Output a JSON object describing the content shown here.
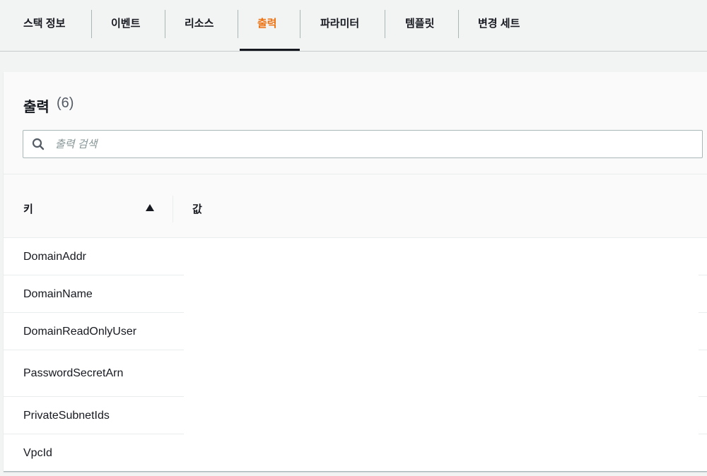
{
  "tabs": [
    {
      "label": "스택 정보",
      "active": false
    },
    {
      "label": "이벤트",
      "active": false
    },
    {
      "label": "리소스",
      "active": false
    },
    {
      "label": "출력",
      "active": true
    },
    {
      "label": "파라미터",
      "active": false
    },
    {
      "label": "템플릿",
      "active": false
    },
    {
      "label": "변경 세트",
      "active": false
    }
  ],
  "panel": {
    "title": "출력",
    "count": "(6)"
  },
  "search": {
    "placeholder": "출력 검색",
    "value": ""
  },
  "table": {
    "columns": {
      "key": "키",
      "value": "값"
    },
    "sort": {
      "column": "key",
      "direction": "ascending",
      "icon": "caret-up-icon"
    },
    "rows": [
      {
        "key": "DomainAddr",
        "value": ""
      },
      {
        "key": "DomainName",
        "value": ""
      },
      {
        "key": "DomainReadOnlyUser",
        "value": ""
      },
      {
        "key": "PasswordSecretArn",
        "value": ""
      },
      {
        "key": "PrivateSubnetIds",
        "value": ""
      },
      {
        "key": "VpcId",
        "value": ""
      }
    ]
  },
  "colors": {
    "accent": "#ec7211",
    "text": "#16191f",
    "muted": "#879596",
    "background": "#f2f3f3"
  }
}
